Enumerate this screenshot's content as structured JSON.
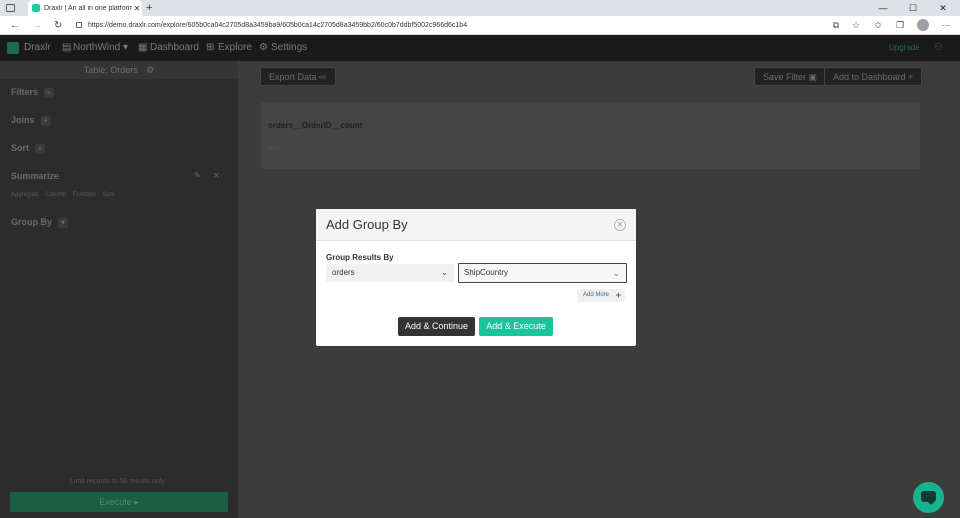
{
  "browser": {
    "tab_title": "Draxlr | An all in one platform to",
    "tab_close": "✕",
    "new_tab": "+",
    "url": "https://demo.draxlr.com/explore/605b0ca04c2705d8a3459ba9/605b0ca14c2705d8a3459bb2/60c0b7ddbf5002c966d6c1b4",
    "window_controls": [
      "—",
      "☐",
      "✕"
    ]
  },
  "appbar": {
    "brand": "Draxlr",
    "workspace": "NorthWind ▾",
    "nav": [
      "Dashboard",
      "Explore",
      "Settings"
    ],
    "right_link": "Upgrade"
  },
  "sidebar": {
    "table_label": "Table: Orders",
    "sections": [
      "Filters",
      "Joins",
      "Sort",
      "Summarize",
      "Group By"
    ],
    "summary_chips": [
      "Aggregate",
      "Column",
      "Function",
      "Sum"
    ],
    "footer": "Limit records to 50 results only",
    "execute": "Execute ▸"
  },
  "main": {
    "export_btn": "Export Data ⇨",
    "save_filter_btn": "Save Filter ▣",
    "add_dashboard_btn": "Add to Dashboard +",
    "card_title": "orders__OrderID__count",
    "card_value": "830"
  },
  "modal": {
    "title": "Add Group By",
    "close": "✕",
    "group_label": "Group Results By",
    "table_select": "orders",
    "column_select": "ShipCountry",
    "add_more": "Add More",
    "add_continue": "Add & Continue",
    "add_execute": "Add & Execute"
  },
  "colors": {
    "accent": "#19c59b",
    "dark": "#333333"
  }
}
